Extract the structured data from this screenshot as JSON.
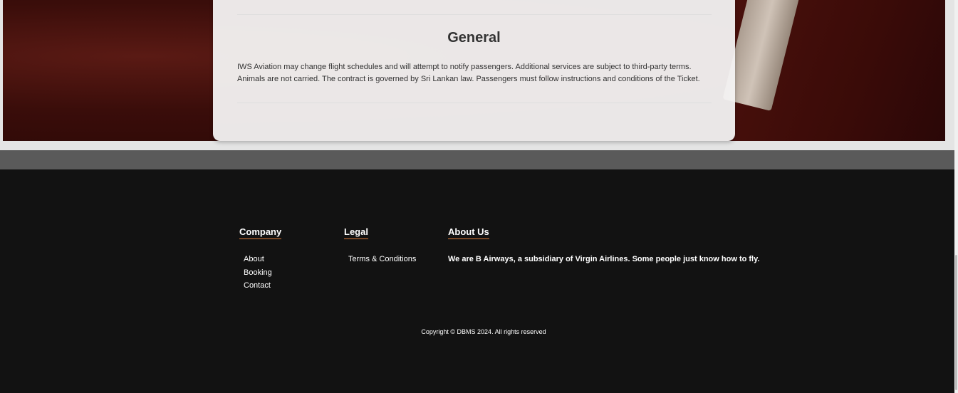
{
  "general": {
    "title": "General",
    "body": "IWS Aviation may change flight schedules and will attempt to notify passengers. Additional services are subject to third-party terms. Animals are not carried. The contract is governed by Sri Lankan law. Passengers must follow instructions and conditions of the Ticket."
  },
  "footer": {
    "company": {
      "title": "Company",
      "links": [
        "About",
        "Booking",
        "Contact"
      ]
    },
    "legal": {
      "title": "Legal",
      "links": [
        "Terms & Conditions"
      ]
    },
    "about": {
      "title": "About Us",
      "text": "We are B Airways, a subsidiary of Virgin Airlines. Some people just know how to fly."
    },
    "copyright": "Copyright © DBMS 2024. All rights reserved"
  },
  "colors": {
    "footer_bg": "#121212",
    "accent_underline": "#e07b39",
    "hero_bg": "#3a0d0a"
  }
}
